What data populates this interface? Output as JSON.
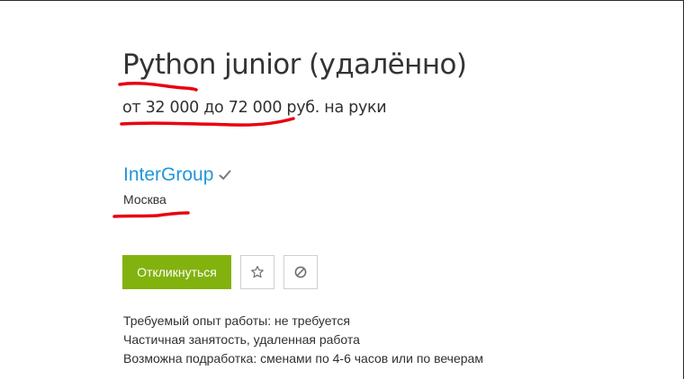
{
  "vacancy": {
    "title": "Python junior (удалённо)",
    "salary": "от 32 000 до 72 000 руб. на руки"
  },
  "employer": {
    "name": "InterGroup",
    "verified_icon": "check-icon",
    "city": "Москва"
  },
  "actions": {
    "respond_label": "Откликнуться",
    "favorite_icon": "star-icon",
    "hide_icon": "block-icon"
  },
  "details": [
    "Требуемый опыт работы: не требуется",
    "Частичная занятость, удаленная работа",
    "Возможна подработка: сменами по 4-6 часов или по вечерам"
  ],
  "colors": {
    "employer_link": "#2196d8",
    "respond_button": "#82b20e",
    "annotation_marks": "#e8000f"
  }
}
